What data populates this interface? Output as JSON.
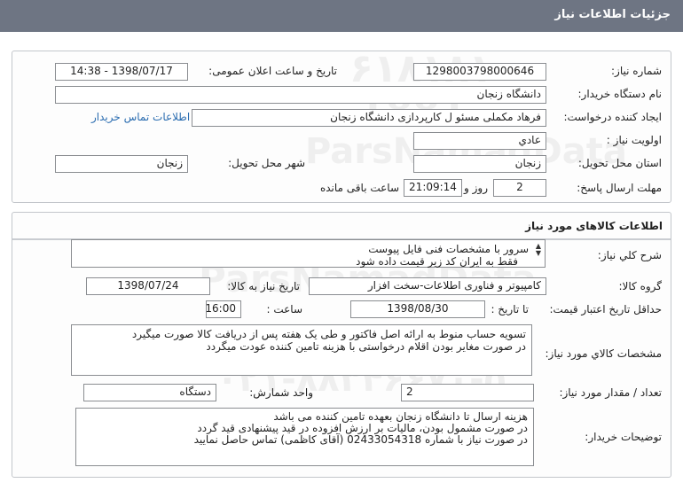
{
  "header": {
    "title": "جزئیات اطلاعات نیاز"
  },
  "need_info": {
    "need_number_label": "شماره نیاز:",
    "need_number": "1298003798000646",
    "announce_label": "تاریخ و ساعت اعلان عمومی:",
    "announce_value": "1398/07/17 - 14:38",
    "buyer_label": "نام دستگاه خریدار:",
    "buyer_value": "دانشگاه زنجان",
    "creator_label": "ایجاد کننده درخواست:",
    "creator_value": "فرهاد مکملی مسئو ل کارپردازی دانشگاه زنجان",
    "contact_link": "اطلاعات تماس خریدار",
    "priority_label": "اولویت نیاز :",
    "priority_value": "عادي",
    "province_label": "استان محل تحویل:",
    "province_value": "زنجان",
    "city_label": "شهر محل تحویل:",
    "city_value": "زنجان",
    "deadline_label": "مهلت ارسال پاسخ:",
    "days_value": "2",
    "days_unit": "روز و",
    "time_value": "21:09:14",
    "remaining_text": "ساعت باقی مانده"
  },
  "goods": {
    "section_title": "اطلاعات کالاهای مورد نیاز",
    "summary_label": "شرح کلي نیاز:",
    "summary_lines": [
      "سرور با مشخصات فنی فایل پیوست",
      "فقط به ایران کد زیر قیمت داده شود"
    ],
    "group_label": "گروه کالا:",
    "group_value": "کامپیوتر و فناوری اطلاعات-سخت افزار",
    "need_date_label": "تاریخ نیاز به کالا:",
    "need_date_value": "1398/07/24",
    "validity_label": "حداقل تاریخ اعتبار قیمت:",
    "to_date_label": "تا تاریخ :",
    "to_date_value": "1398/08/30",
    "hour_label": "ساعت :",
    "hour_value": "16:00",
    "spec_label": "مشخصات کالاي مورد نیاز:",
    "spec_lines": [
      "تسویه حساب منوط به ارائه اصل فاکتور و طی یک هفته پس از دریافت کالا صورت میگیرد",
      "در صورت مغایر بودن اقلام درخواستی با هزینه تامین کننده عودت میگردد"
    ],
    "qty_label": "تعداد / مقدار مورد نیاز:",
    "qty_value": "2",
    "unit_label": "واحد شمارش:",
    "unit_value": "دستگاه",
    "notes_label": "توضیحات خریدار:",
    "notes_lines": [
      "هزینه ارسال تا دانشگاه زنجان بعهده تامین کننده می باشد",
      "در صورت مشمول بودن، مالیات بر ارزش افزوده در قید پیشنهادی قید گردد",
      "در صورت نیاز با شماره 02433054318 (آقای کاظمی) تماس حاصل نمایید"
    ]
  }
}
